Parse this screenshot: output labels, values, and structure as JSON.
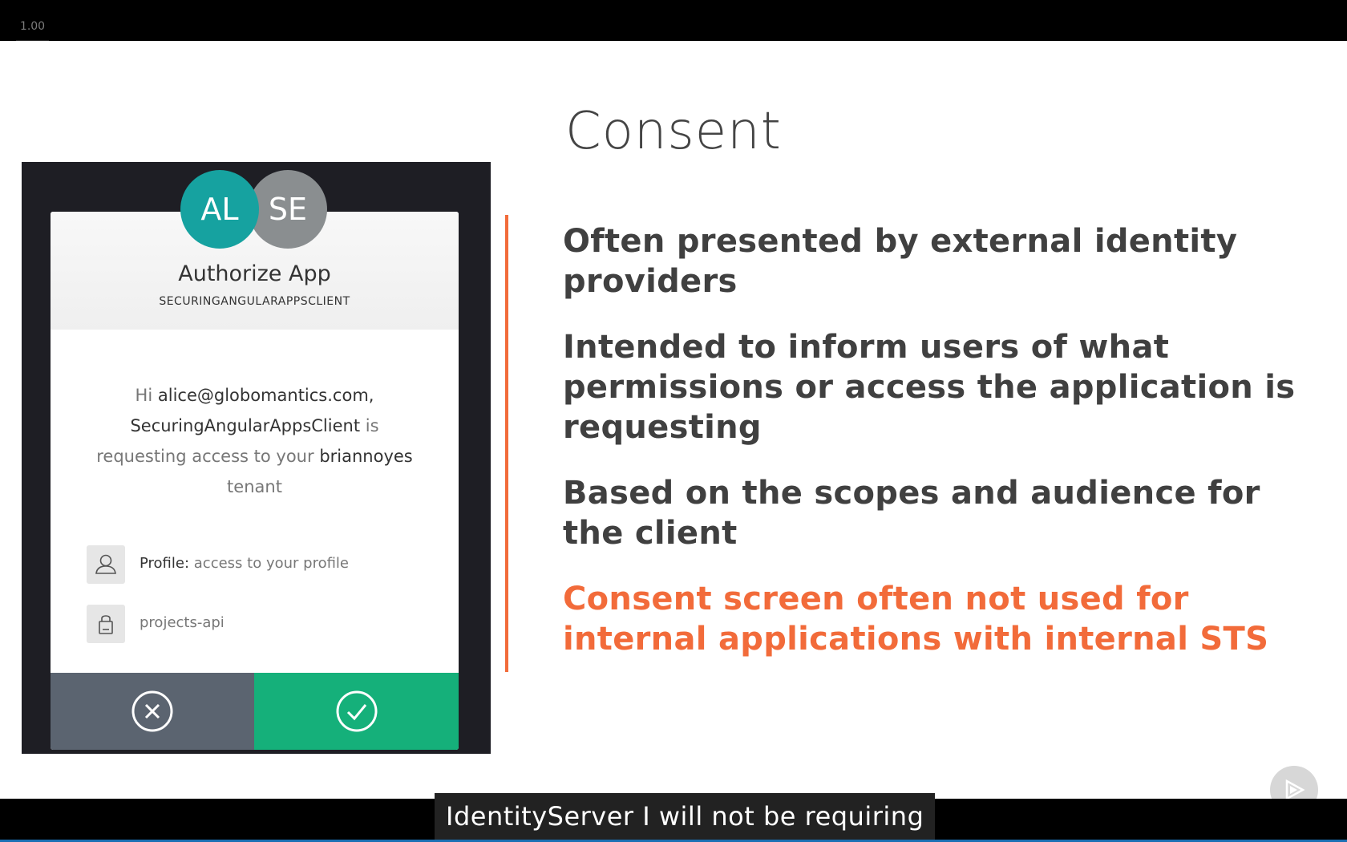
{
  "player": {
    "speed": "1.00",
    "caption": "IdentityServer I will not be requiring"
  },
  "slide": {
    "title": "Consent",
    "bullets": [
      "Often presented by external identity providers",
      "Intended to inform users of what permissions or access the application is requesting",
      "Based on the scopes and audience for the client",
      "Consent screen often not used for internal applications with internal STS"
    ],
    "accent_color": "#f26b3a"
  },
  "consent_dialog": {
    "avatars": [
      "AL",
      "SE"
    ],
    "title": "Authorize App",
    "client_id": "SECURINGANGULARAPPSCLIENT",
    "message": {
      "greeting": "Hi",
      "email": "alice@globomantics.com,",
      "client": "SecuringAngularAppsClient",
      "is": "is",
      "requesting": "requesting access to your",
      "tenant_name": "briannoyes",
      "tenant_word": "tenant"
    },
    "permissions": [
      {
        "icon": "user-icon",
        "label": "Profile:",
        "text": "access to your profile"
      },
      {
        "icon": "lock-icon",
        "label": "",
        "text": "projects-api"
      }
    ],
    "deny_icon": "close-circle-icon",
    "allow_icon": "check-circle-icon",
    "allow_color": "#15b07a",
    "deny_color": "#5b6470"
  }
}
